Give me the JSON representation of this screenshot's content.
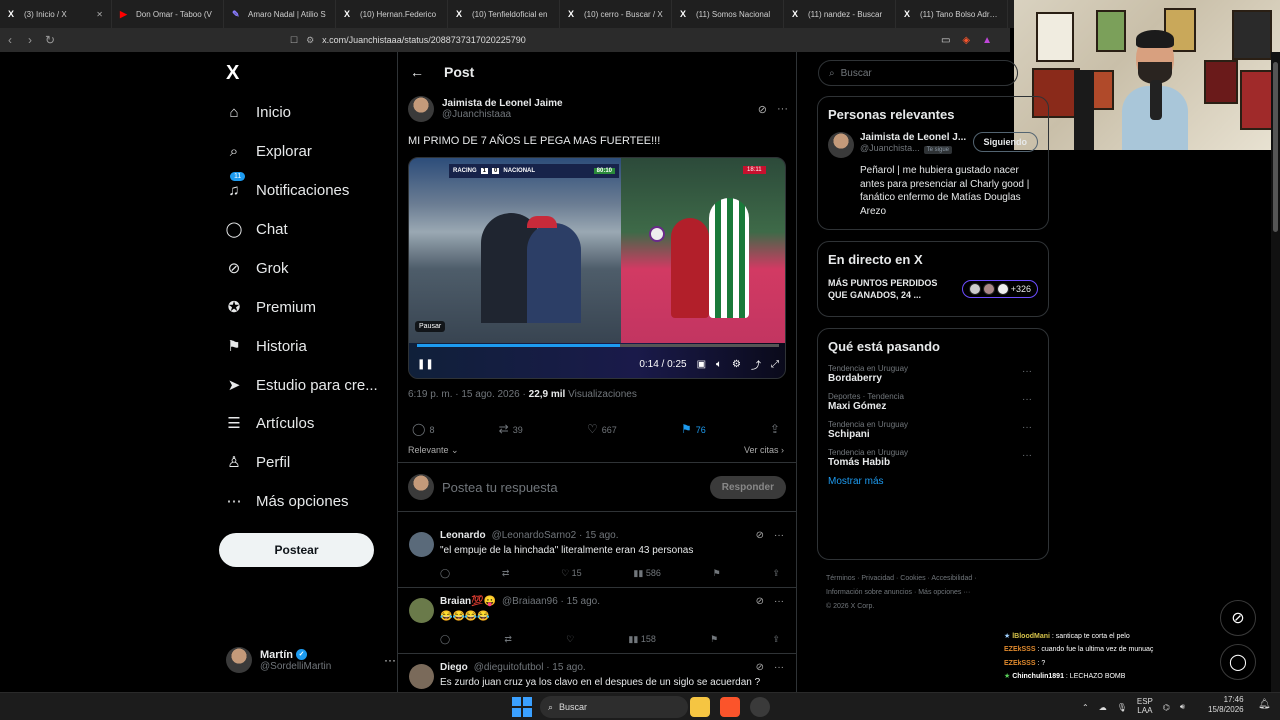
{
  "browser": {
    "tabs": [
      {
        "icon": "X",
        "title": "(3) Inicio / X"
      },
      {
        "icon": "▶",
        "title": "Don Omar - Taboo (V"
      },
      {
        "icon": "✎",
        "title": "Amaro Nadal | Atilio S"
      },
      {
        "icon": "X",
        "title": "(10) Hernan.Federico"
      },
      {
        "icon": "X",
        "title": "(10) Tenfieldoficial en"
      },
      {
        "icon": "X",
        "title": "(10) cerro - Buscar / X"
      },
      {
        "icon": "X",
        "title": "(11) Somos Nacional"
      },
      {
        "icon": "X",
        "title": "(11) nandez - Buscar"
      },
      {
        "icon": "X",
        "title": "(11) Tano Bolso Adrian"
      }
    ],
    "url": "x.com/Juanchistaaa/status/2088737317020225790"
  },
  "left_nav": {
    "logo": "X",
    "items": [
      {
        "label": "Inicio",
        "icon": "⌂"
      },
      {
        "label": "Explorar",
        "icon": "⌕"
      },
      {
        "label": "Notificaciones",
        "icon": "♫",
        "badge": "11"
      },
      {
        "label": "Chat",
        "icon": "◯"
      },
      {
        "label": "Grok",
        "icon": "⊘"
      },
      {
        "label": "Premium",
        "icon": "✪"
      },
      {
        "label": "Historia",
        "icon": "⚑"
      },
      {
        "label": "Estudio para cre...",
        "icon": "➤"
      },
      {
        "label": "Artículos",
        "icon": "☰"
      },
      {
        "label": "Perfil",
        "icon": "♙"
      },
      {
        "label": "Más opciones",
        "icon": "⋯"
      }
    ],
    "post_button": "Postear",
    "account": {
      "name": "Martín",
      "handle": "@SordelliMartin"
    }
  },
  "post": {
    "header": "Post",
    "author_name": "Jaimista de Leonel Jaime",
    "author_handle": "@Juanchistaaa",
    "text": "MI PRIMO DE 7 AÑOS LE PEGA MAS FUERTEE!!!",
    "video": {
      "team_home": "RACING",
      "score_home": "1",
      "score_away": "0",
      "team_away": "NACIONAL",
      "clock": "80:10",
      "right_clock": "18:11",
      "tooltip": "Pausar",
      "time": "0:14 / 0:25",
      "progress": 0.56
    },
    "timestamp": "6:19 p. m. · 15 ago. 2026 ·",
    "views_count": "22,9 mil",
    "views_label": "Visualizaciones",
    "stats": {
      "replies": "8",
      "reposts": "39",
      "likes": "667",
      "bookmarks": "76"
    },
    "relevant_label": "Relevante",
    "quotes_label": "Ver citas",
    "reply_placeholder": "Postea tu respuesta",
    "reply_button": "Responder"
  },
  "comments": [
    {
      "name": "Leonardo",
      "handle": "@LeonardoSarno2 · 15 ago.",
      "text": "\"el empuje de la hinchada\" literalmente eran 43 personas",
      "likes": "15",
      "views": "586"
    },
    {
      "name": "Braian💯😛",
      "handle": "@Braiaan96 · 15 ago.",
      "text": "😂😂😂😂",
      "likes": "",
      "views": "158"
    },
    {
      "name": "Diego",
      "handle": "@dieguitofutbol · 15 ago.",
      "text": "Es zurdo juan cruz ya los clavo en el despues de un siglo se acuerdan ?",
      "likes": "",
      "views": ""
    }
  ],
  "right_col": {
    "search_placeholder": "Buscar",
    "relevant": {
      "title": "Personas relevantes",
      "name": "Jaimista de Leonel J...",
      "handle": "@Juanchista...",
      "follows_you": "Te sigue",
      "follow_button": "Siguiendo",
      "bio": "Peñarol | me hubiera gustado nacer antes para presenciar al Charly good | fanático enfermo de Matías Douglas Arezo"
    },
    "live": {
      "title": "En directo en X",
      "text": "MÁS PUNTOS PERDIDOS QUE GANADOS, 24 ...",
      "count": "+326"
    },
    "trends": {
      "title": "Qué está pasando",
      "items": [
        {
          "category": "Tendencia en Uruguay",
          "name": "Bordaberry"
        },
        {
          "category": "Deportes · Tendencia",
          "name": "Maxi Gómez"
        },
        {
          "category": "Tendencia en Uruguay",
          "name": "Schipani"
        },
        {
          "category": "Tendencia en Uruguay",
          "name": "Tomás Habib"
        }
      ],
      "show_more": "Mostrar más"
    },
    "footer": {
      "line1": "Términos · Privacidad · Cookies · Accesibilidad ·",
      "line2": "Información sobre anuncios · Más opciones ···",
      "line3": "© 2026 X Corp."
    }
  },
  "stream_chat": [
    {
      "user": "lBloodMani",
      "msg": ": santicap te corta el pelo"
    },
    {
      "user": "EZEkSSS",
      "msg": ": cuando fue la ultima vez de munuaç"
    },
    {
      "user": "EZEkSSS",
      "msg": ": ?"
    },
    {
      "user": "Chinchulin1891",
      "msg": ": LECHAZO BOMB"
    }
  ],
  "taskbar": {
    "search": "Buscar",
    "lang1": "ESP",
    "lang2": "LAA",
    "time": "17:46",
    "date": "15/8/2026"
  }
}
